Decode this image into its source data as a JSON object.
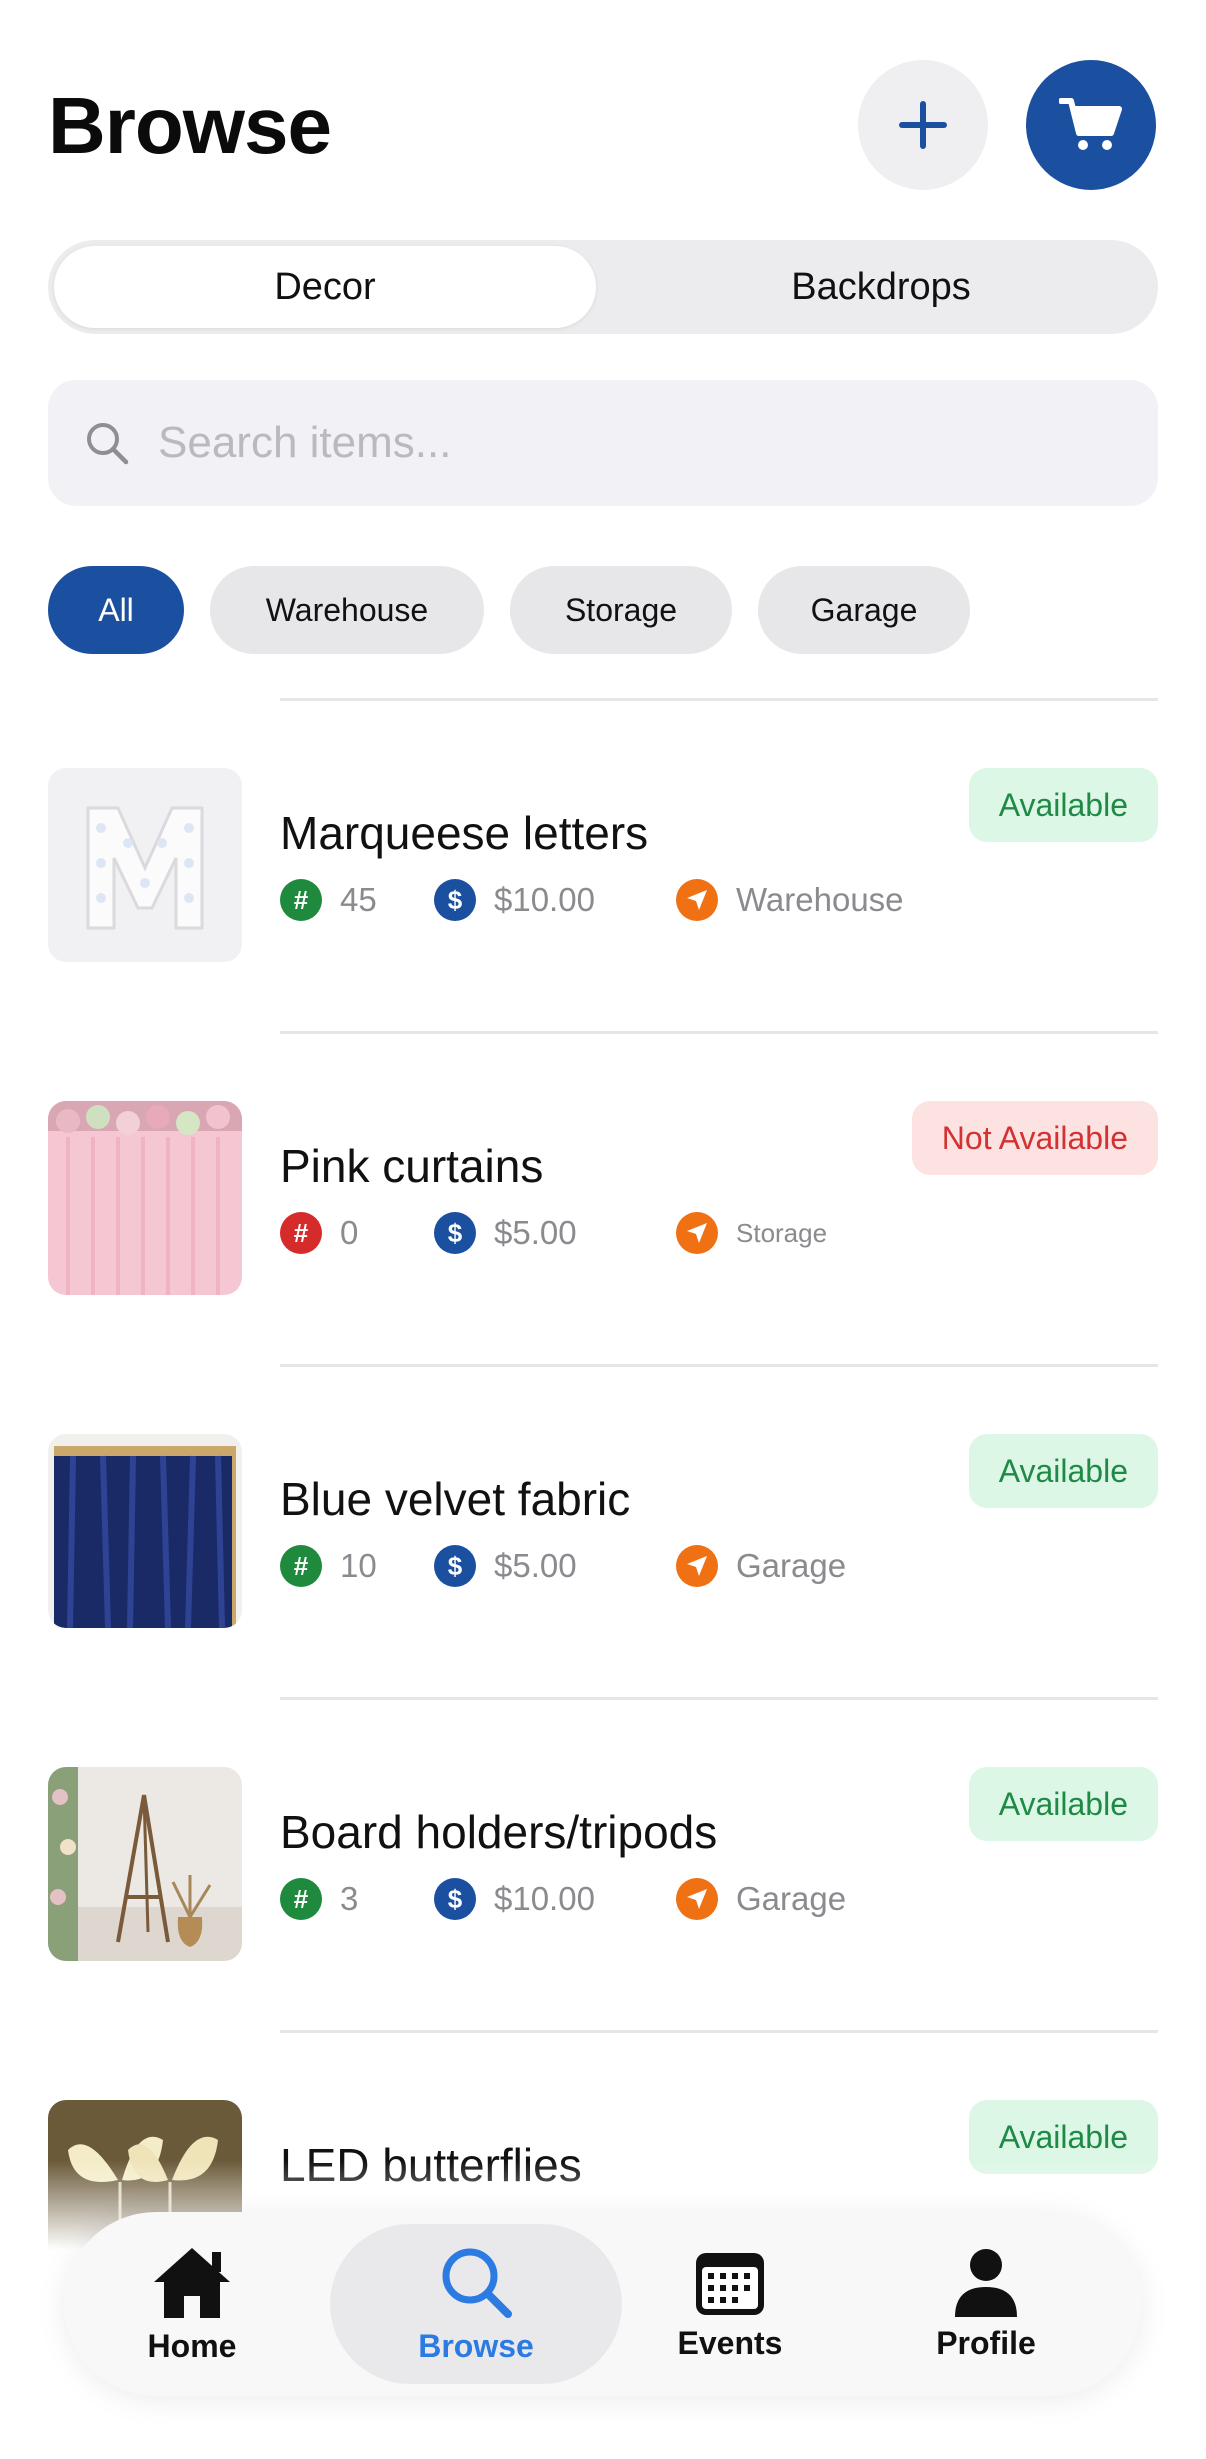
{
  "header": {
    "title": "Browse",
    "add_icon": "plus-icon",
    "cart_icon": "cart-icon",
    "accent": "#1b4fa0"
  },
  "segments": [
    "Decor",
    "Backdrops"
  ],
  "search": {
    "placeholder": "Search items..."
  },
  "filters": [
    "All",
    "Warehouse",
    "Storage",
    "Garage"
  ],
  "items": [
    {
      "name": "Marqueese letters",
      "quantity": "45",
      "price": "$10.00",
      "location": "Warehouse",
      "status": "Available",
      "qty_color": "#1f8a3e"
    },
    {
      "name": "Pink curtains",
      "quantity": "0",
      "price": "$5.00",
      "location": "Storage",
      "status": "Not Available",
      "qty_color": "#d52b2b"
    },
    {
      "name": "Blue velvet fabric",
      "quantity": "10",
      "price": "$5.00",
      "location": "Garage",
      "status": "Available",
      "qty_color": "#1f8a3e"
    },
    {
      "name": "Board holders/tripods",
      "quantity": "3",
      "price": "$10.00",
      "location": "Garage",
      "status": "Available",
      "qty_color": "#1f8a3e"
    },
    {
      "name": "LED butterflies",
      "status": "Available"
    }
  ],
  "meta_icons": {
    "quantity": "#",
    "price": "$",
    "location": "location-arrow-icon"
  },
  "tabs": [
    {
      "label": "Home",
      "icon": "home-icon"
    },
    {
      "label": "Browse",
      "icon": "search-icon"
    },
    {
      "label": "Events",
      "icon": "calendar-icon"
    },
    {
      "label": "Profile",
      "icon": "person-icon"
    }
  ]
}
